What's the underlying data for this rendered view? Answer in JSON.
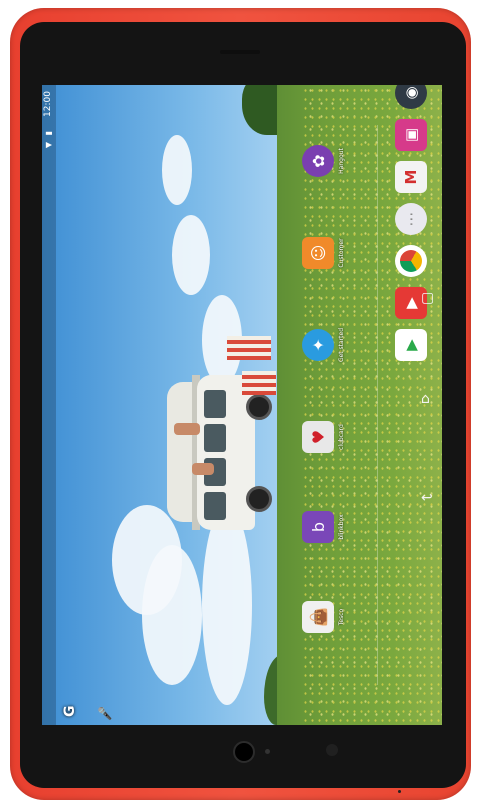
{
  "status_bar": {
    "time": "12:00",
    "icons": [
      "wifi-icon",
      "battery-icon"
    ]
  },
  "search": {
    "google_label": "G",
    "mic": "mic-icon"
  },
  "home_apps": [
    {
      "name": "Tesco",
      "icon": "shopping-bag-icon",
      "color": "#f0f0f0"
    },
    {
      "name": "blinkbox",
      "icon": "blinkbox-icon",
      "color": "#7a47b8"
    },
    {
      "name": "clubcard",
      "icon": "clubcard-icon",
      "color": "#e8e8e8"
    },
    {
      "name": "Get started",
      "icon": "sparkle-icon",
      "color": "#2a9be0"
    },
    {
      "name": "Customer",
      "icon": "smiley-icon",
      "color": "#f08a2a"
    },
    {
      "name": "Hangout",
      "icon": "flower-icon",
      "color": "#7a3fb0"
    }
  ],
  "hotseat": [
    {
      "name": "camera",
      "icon": "camera-icon",
      "color": "#2f3a45"
    },
    {
      "name": "gallery",
      "icon": "gallery-icon",
      "color": "#d63a8a"
    },
    {
      "name": "gmail",
      "icon": "gmail-icon",
      "color": "#f3f3f3"
    },
    {
      "name": "all-apps",
      "icon": "app-drawer-icon",
      "color": "#e9e9ef"
    },
    {
      "name": "chrome",
      "icon": "chrome-icon",
      "color": "#ffffff"
    },
    {
      "name": "youtube",
      "icon": "youtube-icon",
      "color": "#e53935"
    },
    {
      "name": "play-store",
      "icon": "play-store-icon",
      "color": "#ffffff"
    }
  ],
  "navigation": {
    "back": "back-icon",
    "home": "home-icon",
    "recents": "recents-icon"
  },
  "colors": {
    "shell": "#e8402f",
    "bezel": "#141414"
  }
}
